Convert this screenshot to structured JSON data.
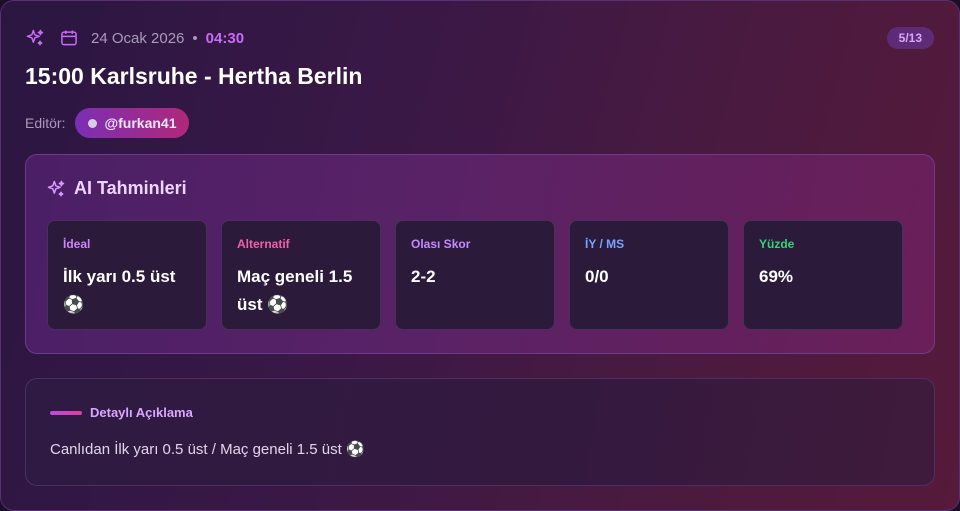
{
  "header": {
    "date": "24 Ocak 2026",
    "separator": "•",
    "time": "04:30",
    "page_badge": "5/13",
    "icons": [
      "sparkles-icon",
      "calendar-icon"
    ]
  },
  "match": {
    "title": "15:00 Karlsruhe - Hertha Berlin"
  },
  "editor": {
    "label": "Editör:",
    "handle": "@furkan41"
  },
  "ai_predictions": {
    "title": "AI Tahminleri",
    "items": [
      {
        "label": "İdeal",
        "value": "İlk yarı 0.5 üst ⚽",
        "color": "#d083ff"
      },
      {
        "label": "Alternatif",
        "value": "Maç geneli 1.5 üst ⚽",
        "color": "#f25fb0"
      },
      {
        "label": "Olası Skor",
        "value": "2-2",
        "color": "#c38bff"
      },
      {
        "label": "İY / MS",
        "value": "0/0",
        "color": "#7aa2ff"
      },
      {
        "label": "Yüzde",
        "value": "69%",
        "color": "#34d37a"
      }
    ]
  },
  "details": {
    "title": "Detaylı Açıklama",
    "text": "Canlıdan İlk yarı 0.5 üst / Maç geneli 1.5 üst ⚽"
  },
  "colors": {
    "accent": "#c86bf5",
    "badge_bg": "#5e2b78"
  }
}
